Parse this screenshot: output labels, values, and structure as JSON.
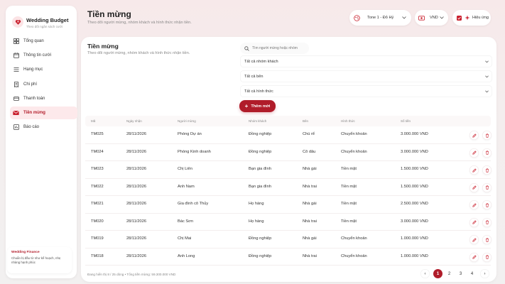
{
  "sidebar": {
    "brand_title": "Wedding Budget",
    "brand_subtitle": "Theo dõi ngân sách cưới",
    "items": [
      {
        "label": "Tổng quan"
      },
      {
        "label": "Thông tin cưới"
      },
      {
        "label": "Hạng mục"
      },
      {
        "label": "Chi phí"
      },
      {
        "label": "Thanh toán"
      },
      {
        "label": "Tiền mừng"
      },
      {
        "label": "Báo cáo"
      }
    ],
    "promo_title": "Wedding Finance",
    "promo_text": "Chuẩn bị đầu từ như kế hoạch, nhẹ nhàng hạnh phúc"
  },
  "header": {
    "title": "Tiền mừng",
    "subtitle": "Theo dõi người mừng, nhóm khách và hình thức nhận tiền.",
    "tone_label": "Tone 1 - Đỏ Hỷ",
    "currency_label": "VND",
    "effects_label": "Hiệu ứng"
  },
  "card": {
    "title": "Tiền mừng",
    "subtitle": "Theo dõi người mừng, nhóm khách và hình thức nhận tiền.",
    "search_placeholder": "Tìm người mừng hoặc nhóm",
    "filters": {
      "group": "Tất cả nhóm khách",
      "side": "Tất cả bên",
      "method": "Tất cả hình thức"
    },
    "add_label": "Thêm mới"
  },
  "table": {
    "headers": {
      "code": "Mã",
      "date": "Ngày nhận",
      "giver": "Người mừng",
      "group": "Nhóm khách",
      "side": "Bên",
      "method": "Hình thức",
      "amount": "Số tiền"
    },
    "rows": [
      {
        "code": "TM025",
        "date": "28/11/2026",
        "giver": "Phòng Dự án",
        "group": "Đồng nghiệp",
        "side": "Chú rể",
        "method": "Chuyển khoản",
        "amount": "3.000.000 VND"
      },
      {
        "code": "TM024",
        "date": "28/11/2026",
        "giver": "Phòng Kinh doanh",
        "group": "Đồng nghiệp",
        "side": "Cô dâu",
        "method": "Chuyển khoản",
        "amount": "3.000.000 VND"
      },
      {
        "code": "TM023",
        "date": "28/11/2026",
        "giver": "Chị Liên",
        "group": "Bạn gia đình",
        "side": "Nhà gái",
        "method": "Tiền mặt",
        "amount": "1.500.000 VND"
      },
      {
        "code": "TM022",
        "date": "28/11/2026",
        "giver": "Anh Nam",
        "group": "Bạn gia đình",
        "side": "Nhà trai",
        "method": "Tiền mặt",
        "amount": "1.500.000 VND"
      },
      {
        "code": "TM021",
        "date": "28/11/2026",
        "giver": "Gia đình cô Thủy",
        "group": "Họ hàng",
        "side": "Nhà gái",
        "method": "Tiền mặt",
        "amount": "2.500.000 VND"
      },
      {
        "code": "TM020",
        "date": "28/11/2026",
        "giver": "Bác Sơn",
        "group": "Họ hàng",
        "side": "Nhà trai",
        "method": "Tiền mặt",
        "amount": "3.000.000 VND"
      },
      {
        "code": "TM019",
        "date": "28/11/2026",
        "giver": "Chị Mai",
        "group": "Đồng nghiệp",
        "side": "Nhà gái",
        "method": "Chuyển khoản",
        "amount": "1.000.000 VND"
      },
      {
        "code": "TM018",
        "date": "28/11/2026",
        "giver": "Anh Long",
        "group": "Đồng nghiệp",
        "side": "Nhà trai",
        "method": "Chuyển khoản",
        "amount": "1.000.000 VND"
      }
    ]
  },
  "footer": {
    "info": "Đang hiển thị 8 / 25 dòng • Tổng tiền mừng: 59.300.000 VND",
    "pages": [
      "1",
      "2",
      "3",
      "4"
    ],
    "prev": "‹",
    "next": "›"
  },
  "colors": {
    "accent": "#b01c2a",
    "active_bg": "#fde9eb"
  }
}
